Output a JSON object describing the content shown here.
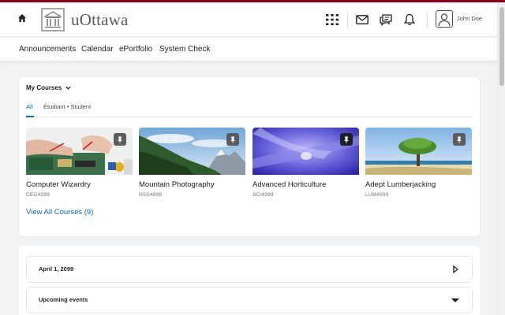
{
  "header": {
    "logo_text": "uOttawa",
    "user_name": "John Doe",
    "icons": [
      "home-icon",
      "waffle-grid-icon",
      "mail-icon",
      "chat-icon",
      "bell-icon",
      "user-avatar-icon"
    ]
  },
  "nav": {
    "items": [
      {
        "label": "Announcements"
      },
      {
        "label": "Calendar"
      },
      {
        "label": "ePortfolio"
      },
      {
        "label": "System Check"
      }
    ]
  },
  "my_courses": {
    "title": "My Courses",
    "tabs": [
      {
        "label": "All",
        "active": true
      },
      {
        "label": "Étudiant • Student",
        "active": false
      }
    ],
    "courses": [
      {
        "name": "Computer Wizardry",
        "code": "CEG4999",
        "pinned": true
      },
      {
        "name": "Mountain Photography",
        "code": "HSS4999",
        "pinned": true
      },
      {
        "name": "Advanced Horticulture",
        "code": "SCI4999",
        "pinned": true
      },
      {
        "name": "Adept Lumberjacking",
        "code": "LUM4999",
        "pinned": true
      }
    ],
    "view_all": "View All Courses (9)"
  },
  "widgets": {
    "date_label": "April 1, 2099",
    "upcoming_label": "Upcoming events"
  },
  "colors": {
    "brand": "#8f001a",
    "link": "#006fbf",
    "text": "#202122"
  }
}
